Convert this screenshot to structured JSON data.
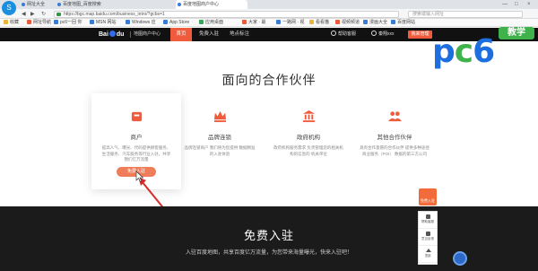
{
  "browser": {
    "logo": "S",
    "tabs": [
      {
        "label": "网址大全"
      },
      {
        "label": "百度地图_百度搜索"
      },
      {
        "label": "百度地图商户中心"
      }
    ],
    "window_controls": [
      "—",
      "□",
      "×"
    ],
    "nav_back": "◀",
    "nav_forward": "▶",
    "nav_reload": "↻",
    "url": "https://bgc.map.baidu.com/business_intro/?gcbs=1",
    "search_placeholder": "搜索或输入网址",
    "bookmarks": [
      {
        "label": "收藏",
        "color": "#e8b63a"
      },
      {
        "label": "网址导航",
        "color": "#e85a3a"
      },
      {
        "label": "pc6一回 你",
        "color": "#3a7bd5"
      },
      {
        "label": "MSN 网站",
        "color": "#3a7bd5"
      },
      {
        "label": "Windows 应",
        "color": "#3a7bd5"
      },
      {
        "label": "App Store",
        "color": "#3a7bd5"
      },
      {
        "label": "应用桌面",
        "color": "#3aa55a"
      },
      {
        "label": "大家 · 最",
        "color": "#e85a3a"
      },
      {
        "label": "一路网 · 视",
        "color": "#3a7bd5"
      },
      {
        "label": "看看猫",
        "color": "#e8b63a"
      },
      {
        "label": "视频频道",
        "color": "#e85a3a"
      },
      {
        "label": "漫画大全",
        "color": "#3a7bd5"
      },
      {
        "label": "百度网站",
        "color": "#3a7bd5"
      }
    ]
  },
  "header": {
    "logo_text": "Bai",
    "logo_text_2": "du",
    "subtitle": "地图商户中心",
    "nav": [
      {
        "label": "首页",
        "active": true
      },
      {
        "label": "免费入驻",
        "active": false
      },
      {
        "label": "地点标注",
        "active": false
      }
    ],
    "help_label": "帮助客服",
    "user_label": "秦翔xxx",
    "login_button": "我来管理"
  },
  "partners": {
    "title": "面向的合作伙伴",
    "cards": [
      {
        "icon": "shop-icon",
        "title": "商户",
        "desc": "提高人气、曝光、代码提供顾客服务、生活服务、汽车服务等行业入驻，共享我们亿万流量",
        "button": "免费入驻"
      },
      {
        "icon": "crown-icon",
        "title": "品牌连锁",
        "desc": "品牌连锁商户 我们将为您提供 数据精准的入驻体验",
        "button": ""
      },
      {
        "icon": "government-icon",
        "title": "政府机构",
        "desc": "政府机构服务需求 负责管理您的相关机构的信息的 机关单位",
        "button": ""
      },
      {
        "icon": "people-icon",
        "title": "其他合作伙伴",
        "desc": "具有合作意愿的合作伙伴 提供多种途径商业服务（POI） 数据的第三方公司",
        "button": ""
      }
    ]
  },
  "footer": {
    "title": "免费入驻",
    "subtitle": "入驻百度地图，共享百度亿万流量，为您带来海量曝光，快来入驻吧！"
  },
  "float": {
    "badge_label": "免费入驻",
    "items": [
      "帮助客服",
      "意见反馈",
      "顶部"
    ]
  },
  "watermark": {
    "p": "p",
    "c": "c",
    "six": "6",
    "badge": "教学"
  },
  "colors": {
    "accent": "#ef5b3c",
    "button": "#f07d5a",
    "header_bg": "#111111",
    "footer_bg": "#1b1b1b",
    "arrow": "#d92a2a"
  }
}
